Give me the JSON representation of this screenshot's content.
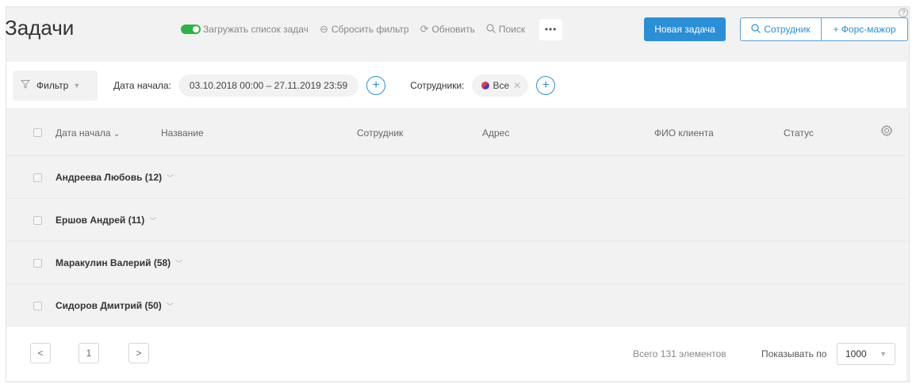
{
  "header": {
    "title": "Задачи",
    "load_tasks_label": "Загружать список задач",
    "reset_filter_label": "Сбросить фильтр",
    "refresh_label": "Обновить",
    "search_label": "Поиск",
    "more_label": "•••",
    "new_task_label": "Новая задача",
    "employee_search_label": "Сотрудник",
    "force_majeure_label": "+ Форс-мажор",
    "help_label": "?",
    "toggle_color": "#2fb344",
    "accent_color": "#2b8fd8"
  },
  "filter": {
    "filter_label": "Фильтр",
    "start_date_label": "Дата начала:",
    "start_date_value": "03.10.2018 00:00 – 27.11.2019 23:59",
    "employees_label": "Сотрудники:",
    "employees_value": "Все",
    "add_label": "+"
  },
  "table": {
    "columns": [
      "Дата начала",
      "Название",
      "Сотрудник",
      "Адрес",
      "ФИО клиента",
      "Статус"
    ],
    "groups": [
      {
        "label": "Андреева Любовь (12)"
      },
      {
        "label": "Ершов Андрей (11)"
      },
      {
        "label": "Маракулин Валерий (58)"
      },
      {
        "label": "Сидоров Дмитрий (50)"
      }
    ]
  },
  "footer": {
    "prev_label": "<",
    "page_label": "1",
    "next_label": ">",
    "total_label": "Всего 131 элементов",
    "per_page_label": "Показывать по",
    "per_page_value": "1000"
  }
}
